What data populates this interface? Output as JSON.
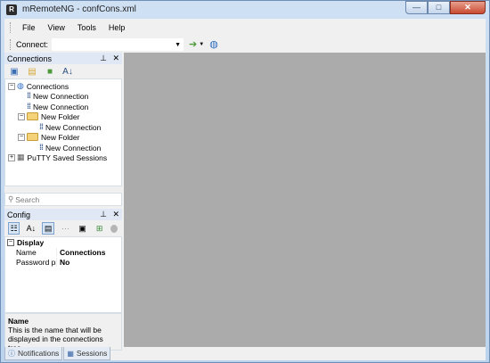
{
  "window": {
    "title": "mRemoteNG - confCons.xml",
    "app_icon_glyph": "R",
    "buttons": {
      "minimize": "—",
      "maximize": "□",
      "close": "✕"
    }
  },
  "menu": [
    "File",
    "View",
    "Tools",
    "Help"
  ],
  "toolbar": {
    "connect_label": "Connect:",
    "connect_value": "",
    "icons": [
      "go-arrow-icon",
      "globe-icon"
    ]
  },
  "connections_panel": {
    "title": "Connections",
    "pin": "📌",
    "close": "✕",
    "tree": [
      {
        "label": "Connections",
        "type": "root"
      },
      {
        "label": "New Connection",
        "type": "connection"
      },
      {
        "label": "New Connection",
        "type": "connection"
      },
      {
        "label": "New Folder",
        "type": "folder"
      },
      {
        "label": "New Connection",
        "type": "connection"
      },
      {
        "label": "New Folder",
        "type": "folder"
      },
      {
        "label": "New Connection",
        "type": "connection"
      },
      {
        "label": "PuTTY Saved Sessions",
        "type": "putty"
      }
    ],
    "search_placeholder": "Search"
  },
  "config_panel": {
    "title": "Config",
    "pin": "📌",
    "close": "✕",
    "category": "Display",
    "rows": [
      {
        "key": "Name",
        "value": "Connections"
      },
      {
        "key": "Password pro",
        "value": "No"
      }
    ],
    "description_title": "Name",
    "description_text": "This is the name that will be displayed in the connections tree."
  },
  "bottom_tabs": [
    "Notifications",
    "Sessions"
  ],
  "colors": {
    "main_area": "#ababab",
    "panel_header": "#dfe8f4",
    "title_gradient_top": "#cfe0f3"
  }
}
